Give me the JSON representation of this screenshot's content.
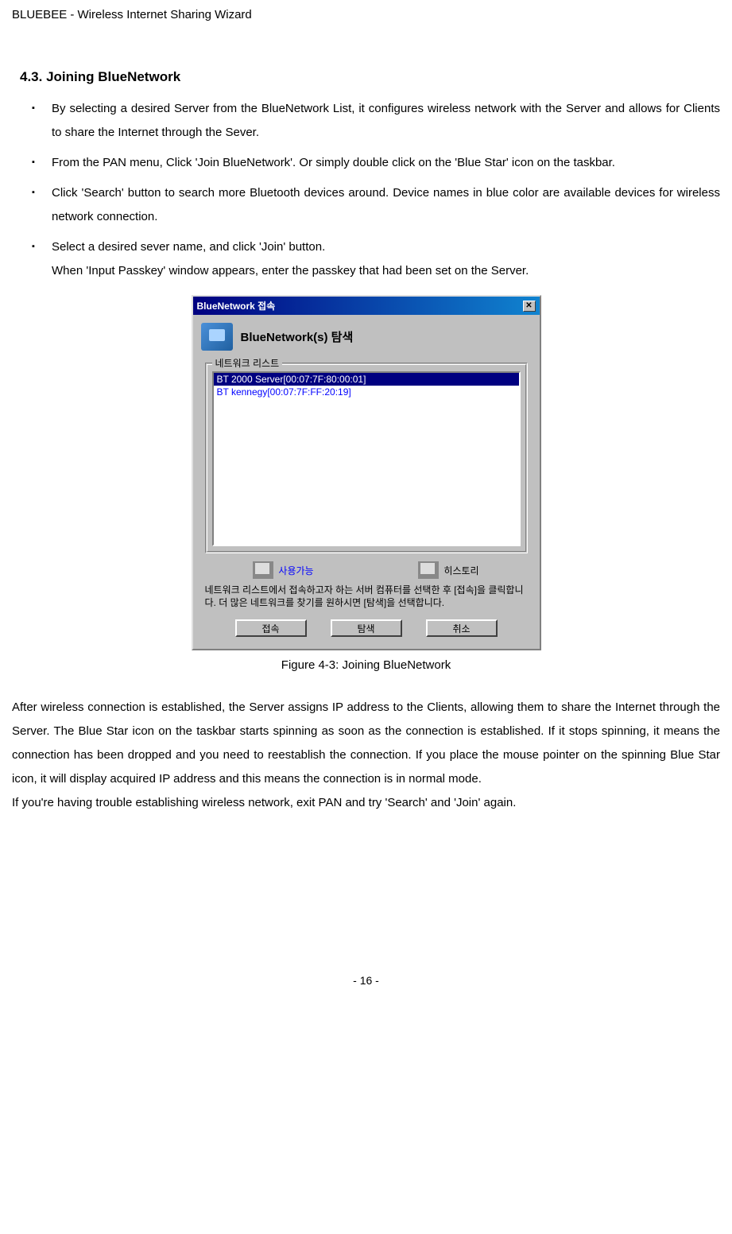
{
  "header": {
    "title": "BLUEBEE - Wireless Internet Sharing Wizard"
  },
  "section": {
    "title": "4.3. Joining BlueNetwork"
  },
  "bullets": [
    {
      "text": "By selecting a desired Server from the BlueNetwork List, it configures wireless network with the Server and allows for Clients to share the Internet through the Sever."
    },
    {
      "text": "From the PAN menu, Click 'Join BlueNetwork'. Or simply double click on the 'Blue Star' icon on the taskbar."
    },
    {
      "text": "Click 'Search' button to search more Bluetooth devices around. Device names in blue color are available devices for wireless network connection."
    },
    {
      "text": "Select a desired sever name, and click 'Join' button.",
      "subtext": "When 'Input Passkey' window appears, enter the passkey that had been set on the Server."
    }
  ],
  "dialog": {
    "titlebar": "BlueNetwork 접속",
    "headerText": "BlueNetwork(s) 탐색",
    "legend": "네트워크 리스트",
    "items": [
      {
        "label": "BT 2000 Server[00:07:7F:80:00:01]",
        "selected": true
      },
      {
        "label": "BT kennegy[00:07:7F:FF:20:19]",
        "selected": false
      }
    ],
    "statusAvailable": "사용가능",
    "statusHistory": "히스토리",
    "helpText": "네트워크 리스트에서 접속하고자 하는 서버 컴퓨터를 선택한 후 [접속]을 클릭합니다. 더 많은 네트워크를 찾기를 원하시면 [탐색]을 선택합니다.",
    "buttons": {
      "connect": "접속",
      "search": "탐색",
      "cancel": "취소"
    }
  },
  "figureCaption": "Figure 4-3: Joining BlueNetwork",
  "bodyParagraphs": [
    "After wireless connection is established, the Server assigns IP address to the Clients, allowing them to share the Internet through the Server. The Blue Star icon on the taskbar starts spinning as soon as the connection is established. If it stops spinning, it means the connection has been dropped and you need to reestablish the connection. If you place the mouse pointer on the spinning Blue Star icon, it will display acquired IP address and this means the connection is in normal mode.",
    "If you're having trouble establishing wireless network, exit PAN and try 'Search' and 'Join' again."
  ],
  "pageNumber": "- 16 -"
}
